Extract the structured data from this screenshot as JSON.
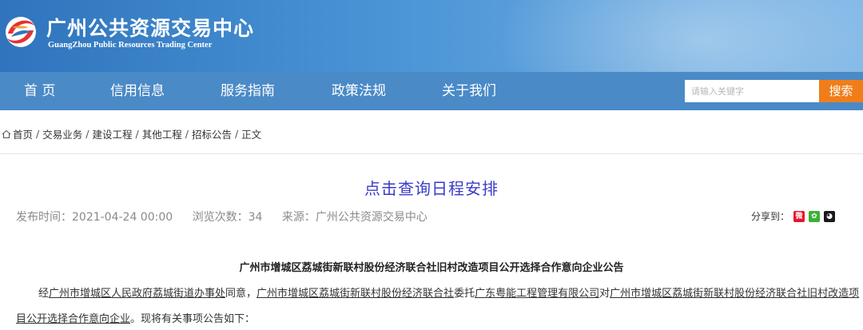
{
  "header": {
    "title_cn": "广州公共资源交易中心",
    "title_en": "GuangZhou Public Resources Trading Center",
    "colors": {
      "gradient_left": "#2f74bd",
      "gradient_right": "#7eb6e6",
      "nav": "#4a8ac7",
      "search_button": "#f07d1a"
    }
  },
  "nav": {
    "items": [
      {
        "label": "首  页"
      },
      {
        "label": "信用信息"
      },
      {
        "label": "服务指南"
      },
      {
        "label": "政策法规"
      },
      {
        "label": "关于我们"
      }
    ],
    "search": {
      "placeholder": "请输入关键字",
      "button_label": "搜索"
    }
  },
  "breadcrumb": {
    "items": [
      "首页",
      "交易业务",
      "建设工程",
      "其他工程",
      "招标公告",
      "正文"
    ],
    "separator": "/"
  },
  "schedule_link": "点击查询日程安排",
  "meta": {
    "published": "发布时间：2021-04-24 00:00",
    "views": "浏览次数：34",
    "source": "来源：广州公共资源交易中心"
  },
  "share": {
    "label": "分享到：",
    "icons": [
      "weibo-icon",
      "wechat-icon",
      "qq-icon"
    ]
  },
  "article": {
    "title": "广州市增城区荔城街新联村股份经济联合社旧村改造项目公开选择合作意向企业公告",
    "p1_a": "经",
    "p1_b": "广州市增城区人民政府荔城街道办事处",
    "p1_c": "同意，",
    "p1_d": "广州市增城区荔城街新联村股份经济联合社",
    "p1_e": "委托",
    "p1_f": "广东粤能工程管理有限公司",
    "p1_g": "对",
    "p1_h": "广州市增城区荔城街新联村股份经济联合社旧村改造项",
    "p2_a": "目公开选择合作意向企业",
    "p2_b": "。现将有关事项公告如下："
  }
}
